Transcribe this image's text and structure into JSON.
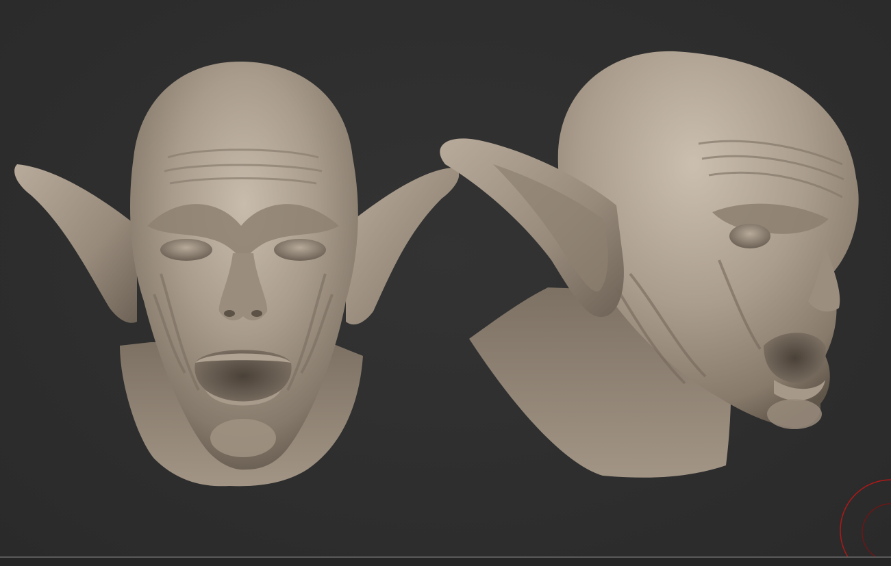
{
  "viewport": {
    "background_color": "#2e2e2e",
    "model_material_color": "#9e9283",
    "model_shadow_color": "#5e5448",
    "model_highlight_color": "#cdc2b4",
    "gizmo_color": "#b01818"
  },
  "models": [
    {
      "name": "goblin-head-front-view"
    },
    {
      "name": "goblin-head-three-quarter-view"
    }
  ],
  "icons": {
    "navigation_gizmo": "orbit-gizmo-icon"
  }
}
